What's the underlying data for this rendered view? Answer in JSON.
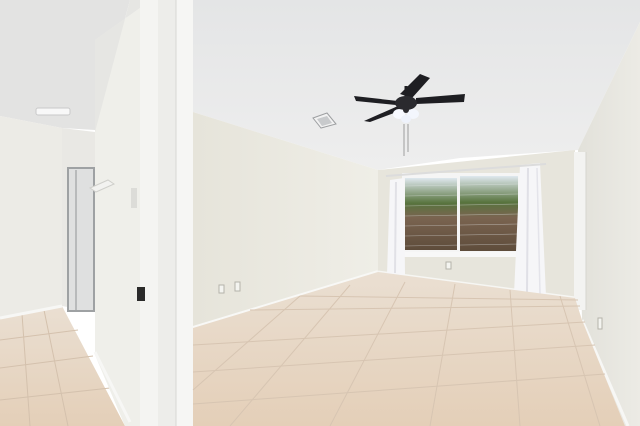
{
  "scene": {
    "kind": "photograph",
    "subject": "empty-room-interior",
    "colors": {
      "ceiling": "#e7e8e9",
      "wall_main": "#ecebe4",
      "wall_shadow": "#dedcd2",
      "wall_right": "#e9e8e2",
      "floor_tile": "#e8d9c8",
      "grout": "#d5c3b0",
      "baseboard": "#f7f7f5",
      "door_frame": "#f4f4f2",
      "fan_body": "#1e1e22",
      "window_frame": "#f5f5f5",
      "curtain": "#f6f6f8",
      "fence": "#6e5a47",
      "trees": "#3d5a2c",
      "sky": "#dfe8ee"
    },
    "icons": [
      "ceiling-fan-icon",
      "light-fixture-icon",
      "air-vent-icon",
      "outlet-icon",
      "towel-hook-icon",
      "door-hinge-icon"
    ]
  }
}
